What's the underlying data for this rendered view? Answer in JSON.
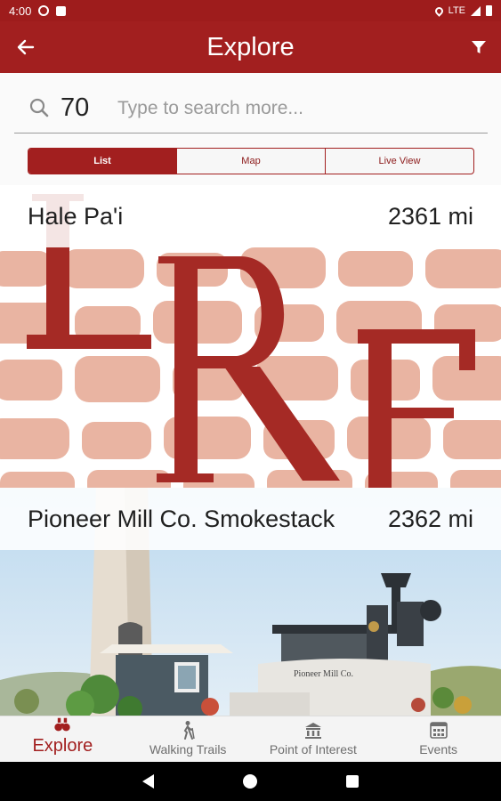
{
  "status_bar": {
    "time": "4:00",
    "network": "LTE"
  },
  "app_bar": {
    "title": "Explore",
    "back_icon": "arrow-left-icon",
    "filter_icon": "filter-icon"
  },
  "search": {
    "value": "70",
    "placeholder": "Type to search more..."
  },
  "view_tabs": [
    {
      "label": "List",
      "active": true
    },
    {
      "label": "Map",
      "active": false
    },
    {
      "label": "Live View",
      "active": false
    }
  ],
  "results": [
    {
      "name": "Hale Pa'i",
      "distance": "2361 mi",
      "image": "lre-logo-stone-wall"
    },
    {
      "name": "Pioneer Mill Co. Smokestack",
      "distance": "2362 mi",
      "image": "smokestack-locomotive-photo"
    }
  ],
  "photo_sign_text": "Pioneer Mill Co.",
  "bottom_nav": [
    {
      "label": "Explore",
      "icon": "binoculars-icon",
      "active": true
    },
    {
      "label": "Walking Trails",
      "icon": "hiker-icon",
      "active": false
    },
    {
      "label": "Point of Interest",
      "icon": "landmark-icon",
      "active": false
    },
    {
      "label": "Events",
      "icon": "calendar-icon",
      "active": false
    }
  ],
  "colors": {
    "brand": "#a21f1f",
    "status_bar": "#9e1c1c"
  }
}
